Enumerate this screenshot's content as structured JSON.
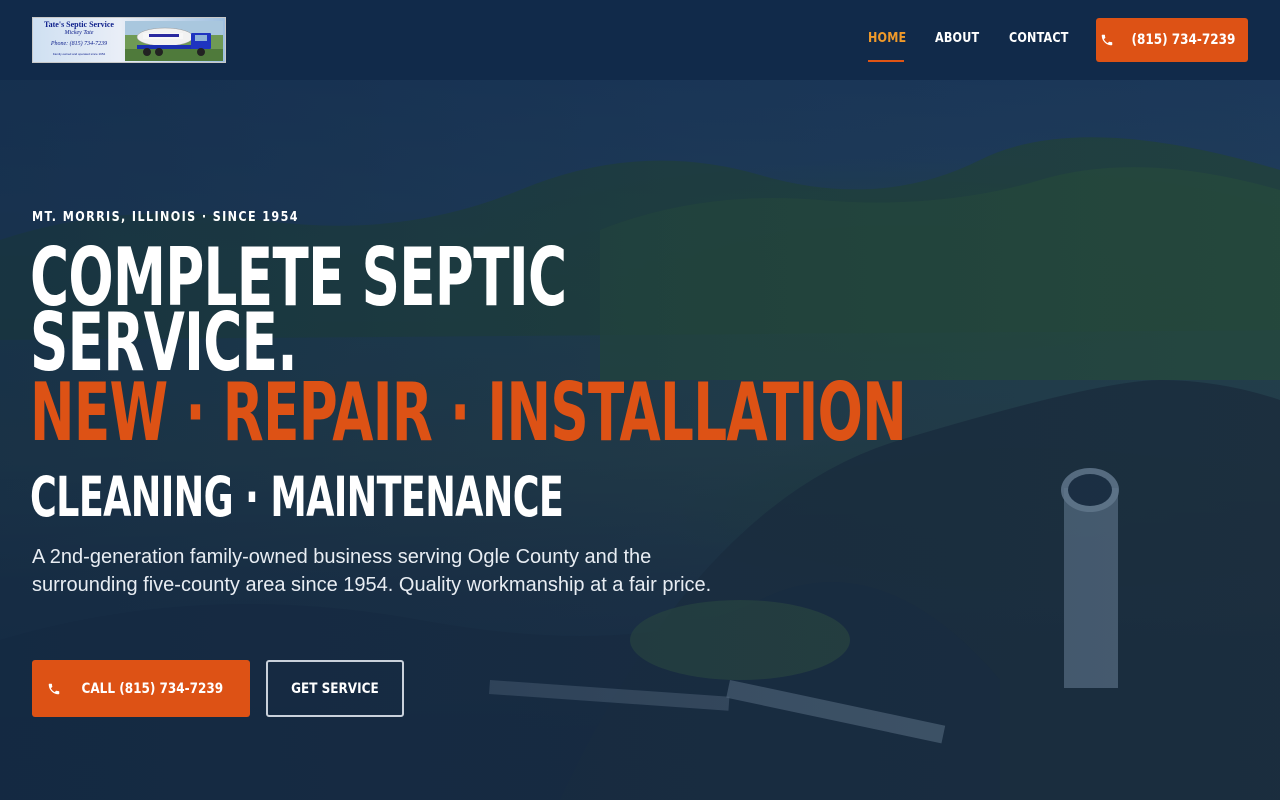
{
  "logo": {
    "line1": "Tate's Septic Service",
    "line2": "Mickey Tate",
    "line3": "Phone: (815) 734-7239",
    "line4": "Family owned and operated since 1954"
  },
  "nav": {
    "items": [
      {
        "label": "HOME",
        "active": true
      },
      {
        "label": "ABOUT",
        "active": false
      },
      {
        "label": "CONTACT",
        "active": false
      }
    ],
    "phone_label": "(815) 734-7239",
    "active_color": "#f09a2a"
  },
  "hero": {
    "eyebrow": "MT. MORRIS, ILLINOIS · SINCE 1954",
    "headline_line1": "COMPLETE SEPTIC",
    "headline_line2": "SERVICE.",
    "headline_accent": "NEW · REPAIR · INSTALLATION",
    "headline_secondary": "CLEANING · MAINTENANCE",
    "description": "A 2nd-generation family-owned business serving Ogle County and the surrounding five-county area since 1954. Quality workmanship at a fair price.",
    "cta_call_label": "CALL (815) 734-7239",
    "cta_service_label": "GET SERVICE"
  },
  "colors": {
    "header_bg": "#112a4a",
    "accent": "#dd5215",
    "nav_active": "#f09a2a"
  },
  "icons": {
    "phone": "phone-icon"
  }
}
